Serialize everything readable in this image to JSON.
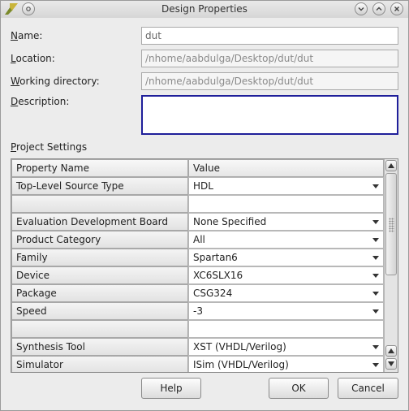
{
  "window": {
    "title": "Design Properties"
  },
  "fields": {
    "name": {
      "label_u": "N",
      "label_rest": "ame:",
      "value": "dut"
    },
    "location": {
      "label_u": "L",
      "label_rest": "ocation:",
      "value": "/nhome/aabdulga/Desktop/dut/dut"
    },
    "working_directory": {
      "label_u": "W",
      "label_rest": "orking directory:",
      "value": "/nhome/aabdulga/Desktop/dut/dut"
    },
    "description": {
      "label_u": "D",
      "label_rest": "escription:",
      "value": ""
    }
  },
  "project_settings": {
    "label_u": "P",
    "label_rest": "roject Settings",
    "columns": [
      "Property Name",
      "Value"
    ],
    "rows": [
      {
        "name": "Top-Level Source Type",
        "value": "HDL",
        "dropdown": true
      },
      {
        "name": "",
        "value": "",
        "dropdown": false
      },
      {
        "name": "Evaluation Development Board",
        "value": "None Specified",
        "dropdown": true
      },
      {
        "name": "Product Category",
        "value": "All",
        "dropdown": true
      },
      {
        "name": "Family",
        "value": "Spartan6",
        "dropdown": true
      },
      {
        "name": "Device",
        "value": "XC6SLX16",
        "dropdown": true
      },
      {
        "name": "Package",
        "value": "CSG324",
        "dropdown": true
      },
      {
        "name": "Speed",
        "value": "-3",
        "dropdown": true
      },
      {
        "name": "",
        "value": "",
        "dropdown": false
      },
      {
        "name": "Synthesis Tool",
        "value": "XST (VHDL/Verilog)",
        "dropdown": true
      },
      {
        "name": "Simulator",
        "value": "ISim (VHDL/Verilog)",
        "dropdown": true
      }
    ]
  },
  "buttons": {
    "help": "Help",
    "ok": "OK",
    "cancel": "Cancel"
  },
  "icons": {
    "app": "xilinx-logo-icon",
    "menu": "window-menu-icon",
    "minimize": "minimize-icon",
    "maximize": "maximize-icon",
    "close": "close-icon",
    "dropdown": "chevron-down-icon"
  }
}
